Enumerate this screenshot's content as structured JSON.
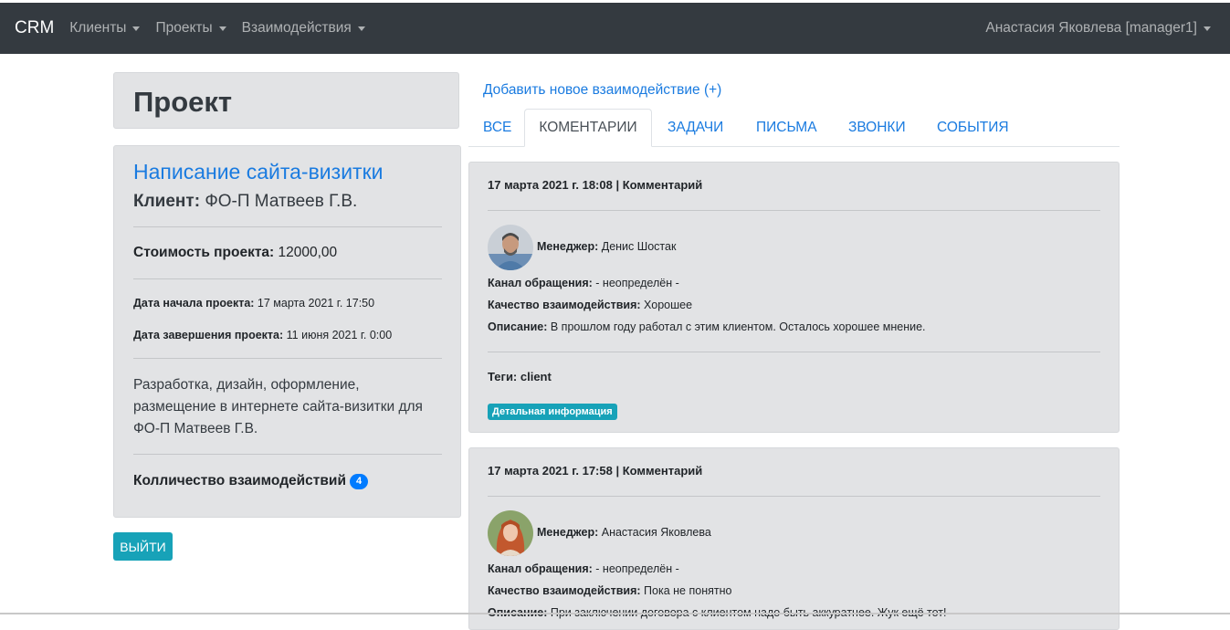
{
  "navbar": {
    "brand": "CRM",
    "items": [
      {
        "label": "Клиенты"
      },
      {
        "label": "Проекты"
      },
      {
        "label": "Взаимодействия"
      }
    ],
    "user": "Анастасия Яковлева [manager1]"
  },
  "page": {
    "heading": "Проект"
  },
  "project": {
    "name": "Написание сайта-визитки",
    "client_label": "Клиент:",
    "client_value": "ФО-П Матвеев Г.В.",
    "cost_label": "Стоимость проекта:",
    "cost_value": "12000,00",
    "start_label": "Дата начала проекта:",
    "start_value": "17 марта 2021 г. 17:50",
    "end_label": "Дата завершения проекта:",
    "end_value": "11 июня 2021 г. 0:00",
    "description": "Разработка, дизайн, оформление, размещение в интернете сайта-визитки для ФО-П Матвеев Г.В.",
    "count_label": "Колличество взаимодействий",
    "count_value": "4"
  },
  "exit_button": "ВЫЙТИ",
  "add_link": "Добавить новое взаимодействие (+)",
  "tabs": [
    {
      "label": "ВСЕ",
      "active": false
    },
    {
      "label": "КОМЕНТАРИИ",
      "active": true
    },
    {
      "label": "ЗАДАЧИ",
      "active": false
    },
    {
      "label": "ПИСЬМА",
      "active": false
    },
    {
      "label": "ЗВОНКИ",
      "active": false
    },
    {
      "label": "СОБЫТИЯ",
      "active": false
    }
  ],
  "interactions": [
    {
      "header": "17 марта 2021 г. 18:08 | Комментарий",
      "manager_label": "Менеджер:",
      "manager": "Денис Шостак",
      "channel_label": "Канал обращения:",
      "channel": "- неопределён -",
      "quality_label": "Качество взаимодействия:",
      "quality": "Хорошее",
      "desc_label": "Описание:",
      "desc": "В прошлом году работал с этим клиентом. Осталось хорошее мнение.",
      "tags": "Теги: client",
      "detail": "Детальная информация"
    },
    {
      "header": "17 марта 2021 г. 17:58 | Комментарий",
      "manager_label": "Менеджер:",
      "manager": "Анастасия Яковлева",
      "channel_label": "Канал обращения:",
      "channel": "- неопределён -",
      "quality_label": "Качество взаимодействия:",
      "quality": "Пока не понятно",
      "desc_label": "Описание:",
      "desc": "При заключении договора с клиентом надо быть аккуратнее. Жук ещё тот!"
    }
  ]
}
